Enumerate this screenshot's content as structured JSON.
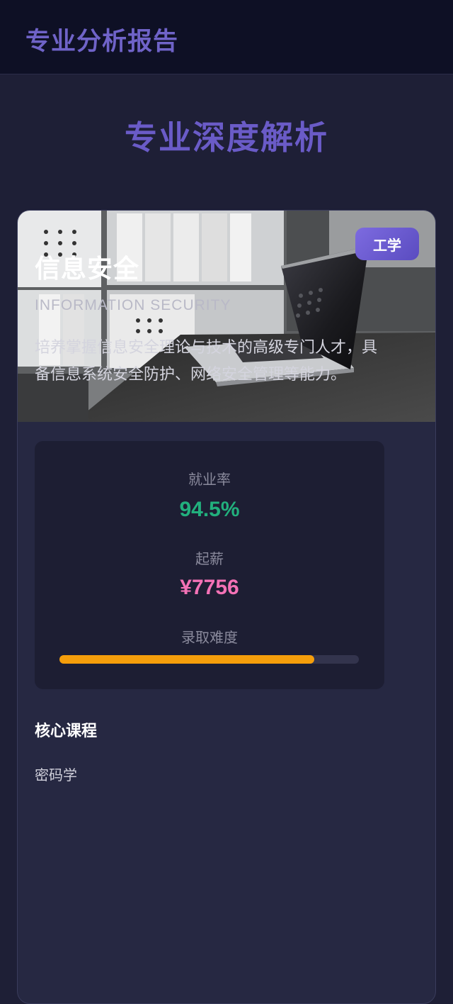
{
  "header": {
    "title": "专业分析报告"
  },
  "page": {
    "heading": "专业深度解析"
  },
  "card": {
    "image_alt": "laptop on desk in office",
    "tag": "工学",
    "name": "信息安全",
    "english_name": "INFORMATION SECURITY",
    "description": "培养掌握信息安全理论与技术的高级专门人才，具备信息系统安全防护、网络安全管理等能力。",
    "stats": {
      "employment_label": "就业率",
      "employment_value": "94.5%",
      "salary_label": "起薪",
      "salary_value": "¥7756",
      "difficulty_label": "录取难度",
      "difficulty_level": 0.85
    },
    "courses_title": "核心课程",
    "courses": [
      "密码学"
    ]
  },
  "colors": {
    "accent": "#6a5bc7",
    "employment": "#22b07d",
    "salary": "#f472b6",
    "difficulty": "#f59e0b"
  }
}
